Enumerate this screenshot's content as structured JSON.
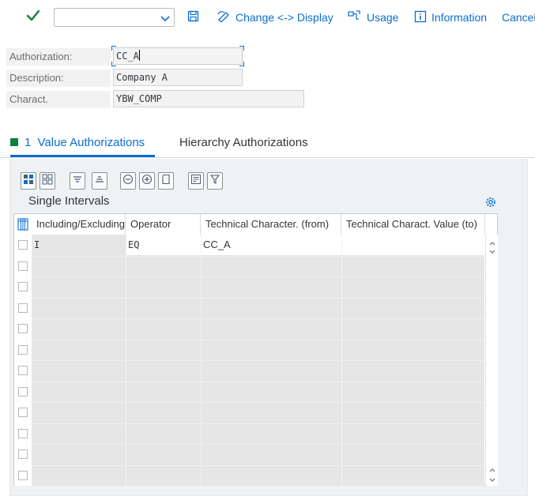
{
  "toolbar": {
    "dropdown_value": "",
    "change_display_label": "Change <-> Display",
    "usage_label": "Usage",
    "information_label": "Information",
    "cancel_label": "Cancel"
  },
  "header": {
    "authorization_label": "Authorization:",
    "authorization_value": "CC_A",
    "description_label": "Description:",
    "description_value": "Company A",
    "charact_label": "Charact.",
    "charact_value": "YBW_COMP"
  },
  "tabs": {
    "active": {
      "number": "1",
      "label": "Value Authorizations"
    },
    "inactive": {
      "label": "Hierarchy Authorizations"
    }
  },
  "table": {
    "title": "Single Intervals",
    "columns": [
      "Including/Excluding",
      "Operator",
      "Technical Character. (from)",
      "Technical Charact. Value (to)"
    ],
    "rows": [
      {
        "incl": "I",
        "op": "EQ",
        "from": "CC_A",
        "to": ""
      }
    ],
    "empty_rows": 11
  },
  "colors": {
    "accent": "#0a6ed1",
    "confirm_green": "#107e3e",
    "panel_bg": "#eef2f5"
  },
  "icons": {
    "toolbar": [
      "checkmark-icon",
      "chevron-down-icon",
      "save-icon",
      "edit-toggle-icon",
      "where-used-icon",
      "information-icon"
    ],
    "table_tools": [
      "select-all-icon",
      "deselect-all-icon",
      "sort-ascending-icon",
      "sort-descending-icon",
      "delete-row-icon",
      "insert-row-icon",
      "copy-row-icon",
      "details-icon",
      "filter-icon"
    ],
    "settings": "settings-gear-icon"
  }
}
